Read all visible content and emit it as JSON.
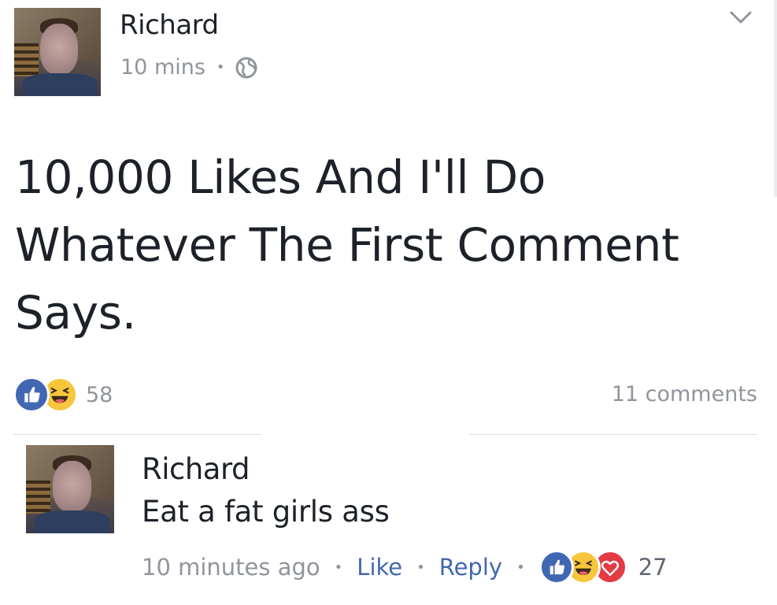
{
  "post": {
    "author": "Richard",
    "time": "10 mins",
    "separator": "•",
    "privacy_icon": "globe-icon",
    "menu_icon": "chevron-down-icon",
    "text": "10,000 Likes And I'll Do Whatever The First Comment Says.",
    "reactions": {
      "types": [
        "like",
        "haha"
      ],
      "count": "58"
    },
    "comments_count": "11 comments"
  },
  "comment": {
    "author": "Richard",
    "text": "Eat a fat girls ass",
    "time": "10 minutes ago",
    "like_label": "Like",
    "reply_label": "Reply",
    "separator": "•",
    "reactions": {
      "types": [
        "like",
        "haha",
        "love"
      ],
      "count": "27"
    }
  },
  "colors": {
    "text": "#1d2129",
    "meta": "#90949c",
    "link": "#4267b2",
    "like": "#4267b2",
    "haha": "#f7c63c",
    "love": "#e33a44"
  }
}
